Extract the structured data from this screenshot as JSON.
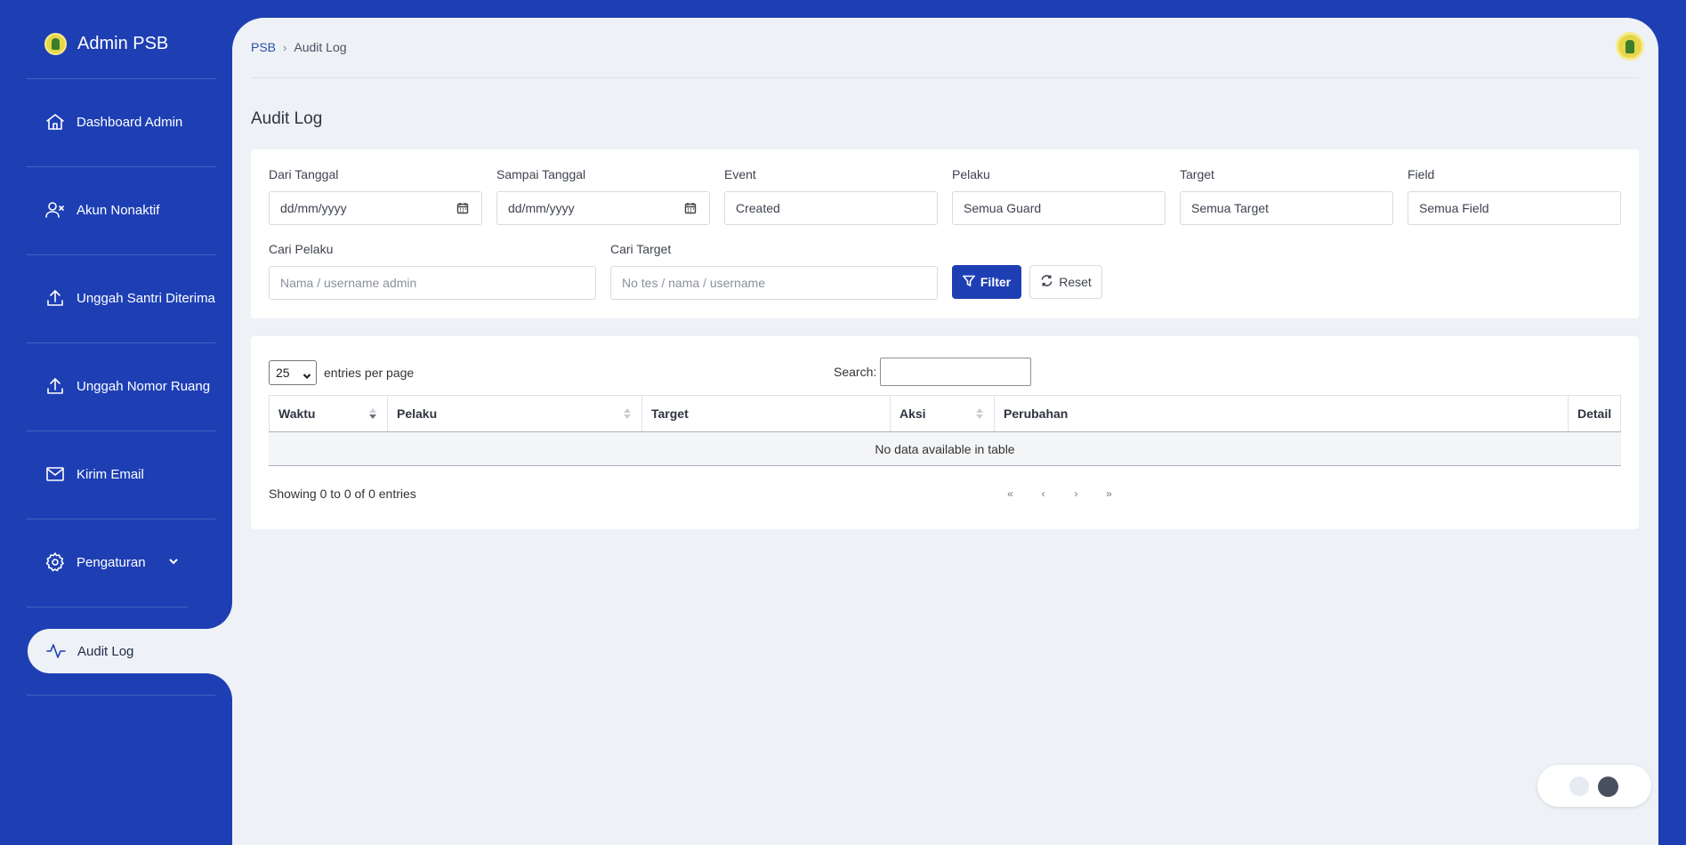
{
  "sidebar": {
    "brand": "Admin PSB",
    "items": [
      {
        "label": "Dashboard Admin",
        "icon": "home-icon"
      },
      {
        "label": "Akun Nonaktif",
        "icon": "user-x-icon"
      },
      {
        "label": "Unggah Santri Diterima",
        "icon": "upload-icon"
      },
      {
        "label": "Unggah Nomor Ruang",
        "icon": "upload-icon"
      },
      {
        "label": "Kirim Email",
        "icon": "mail-icon"
      },
      {
        "label": "Pengaturan",
        "icon": "gear-icon"
      },
      {
        "label": "Audit Log",
        "icon": "activity-icon",
        "active": true
      }
    ]
  },
  "breadcrumb": {
    "root": "PSB",
    "current": "Audit Log"
  },
  "page": {
    "title": "Audit Log"
  },
  "filters": {
    "dari_tanggal": {
      "label": "Dari Tanggal",
      "placeholder": "dd/mm/yyyy"
    },
    "sampai_tanggal": {
      "label": "Sampai Tanggal",
      "placeholder": "dd/mm/yyyy"
    },
    "event": {
      "label": "Event",
      "value": "Created"
    },
    "pelaku": {
      "label": "Pelaku",
      "value": "Semua Guard"
    },
    "target": {
      "label": "Target",
      "value": "Semua Target"
    },
    "field": {
      "label": "Field",
      "value": "Semua Field"
    },
    "cari_pelaku": {
      "label": "Cari Pelaku",
      "placeholder": "Nama / username admin"
    },
    "cari_target": {
      "label": "Cari Target",
      "placeholder": "No tes / nama / username"
    },
    "filter_button": "Filter",
    "reset_button": "Reset"
  },
  "table": {
    "page_length": "25",
    "length_suffix": "entries per page",
    "search_label": "Search:",
    "columns": [
      "Waktu",
      "Pelaku",
      "Target",
      "Aksi",
      "Perubahan",
      "Detail"
    ],
    "empty_message": "No data available in table",
    "info": "Showing 0 to 0 of 0 entries",
    "pager": [
      "«",
      "‹",
      "›",
      "»"
    ]
  },
  "colors": {
    "primary": "#1e3fb4",
    "background": "#eef2f7"
  }
}
